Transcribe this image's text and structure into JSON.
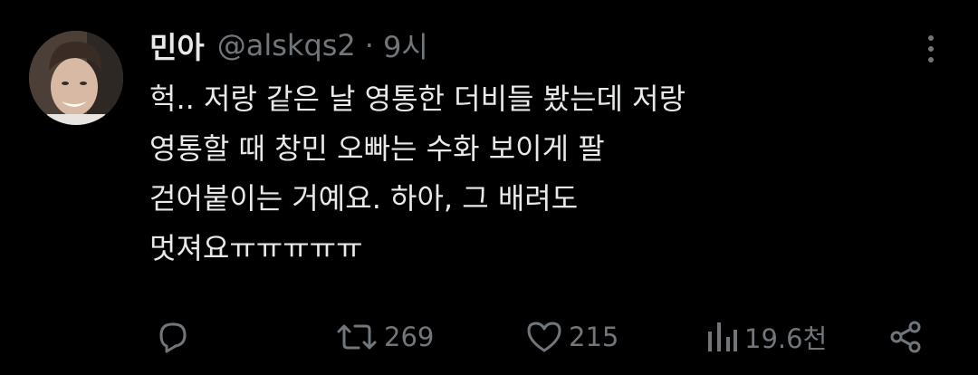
{
  "tweet": {
    "author_name": "민아",
    "author_handle": "@alskqs2",
    "separator": "·",
    "time": "9시",
    "text_lines": [
      "헉.. 저랑 같은 날 영통한 더비들 봤는데 저랑",
      "영통할 때 창민 오빠는 수화 보이게 팔",
      "걷어붙이는 거예요. 하아, 그 배려도",
      "멋져요ㅠㅠㅠㅠㅠ"
    ]
  },
  "actions": {
    "reply": {
      "icon": "reply-icon"
    },
    "retweet": {
      "icon": "retweet-icon",
      "count": "269"
    },
    "like": {
      "icon": "heart-icon",
      "count": "215"
    },
    "views": {
      "icon": "views-icon",
      "count": "19.6천"
    },
    "share": {
      "icon": "share-icon"
    }
  },
  "colors": {
    "background": "#000000",
    "primary_text": "#e7e9ea",
    "secondary_text": "#71767b"
  }
}
